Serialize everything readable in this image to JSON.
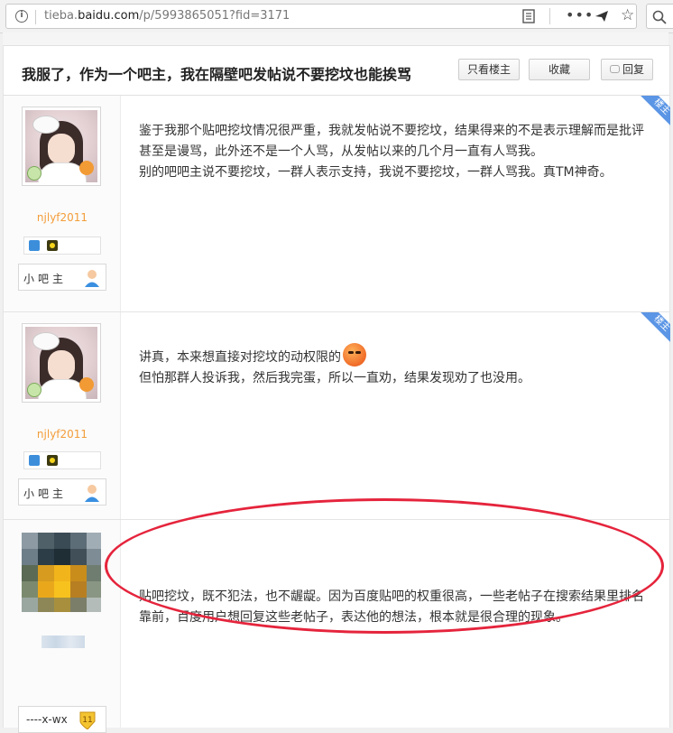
{
  "browser": {
    "url_prefix": "tieba.",
    "url_host": "baidu.com",
    "url_path": "/p/5993865051?fid=3171",
    "icons": [
      "info-icon",
      "reader-view-icon",
      "more-icon",
      "send-icon",
      "bookmark-star-icon",
      "search-icon"
    ]
  },
  "thread": {
    "title": "我服了，作为一个吧主，我在隔壁吧发帖说不要挖坟也能挨骂",
    "buttons": {
      "only_op": "只看楼主",
      "favorite": "收藏",
      "reply": "回复"
    }
  },
  "posts": [
    {
      "badge": "楼主",
      "username": "njlyf2011",
      "role": "小吧主",
      "lines": [
        "鉴于我那个贴吧挖坟情况很严重，我就发帖说不要挖坟，结果得来的不是表示理解而是批评",
        "甚至是谩骂，此外还不是一个人骂，从发帖以来的几个月一直有人骂我。",
        "别的吧吧主说不要挖坟，一群人表示支持，我说不要挖坟，一群人骂我。真TM神奇。"
      ]
    },
    {
      "badge": "楼主",
      "username": "njlyf2011",
      "role": "小吧主",
      "lines": [
        "讲真，本来想直接对挖坟的动权限的",
        "但怕那群人投诉我，然后我完蛋，所以一直劝，结果发现劝了也没用。"
      ]
    },
    {
      "username_hidden": true,
      "role": "----x-wx",
      "level": "11",
      "lines": [
        "贴吧挖坟，既不犯法，也不龌龊。因为百度贴吧的权重很高，一些老帖子在搜索结果里排名",
        "靠前，百度用户想回复这些老帖子，表达他的想法，根本就是很合理的现象。"
      ]
    }
  ],
  "annotation": {
    "color": "#e5243c",
    "shape": "ellipse"
  },
  "colors": {
    "username": "#f39d3a",
    "badge_ribbon": "#5b95e5",
    "text": "#333333"
  }
}
